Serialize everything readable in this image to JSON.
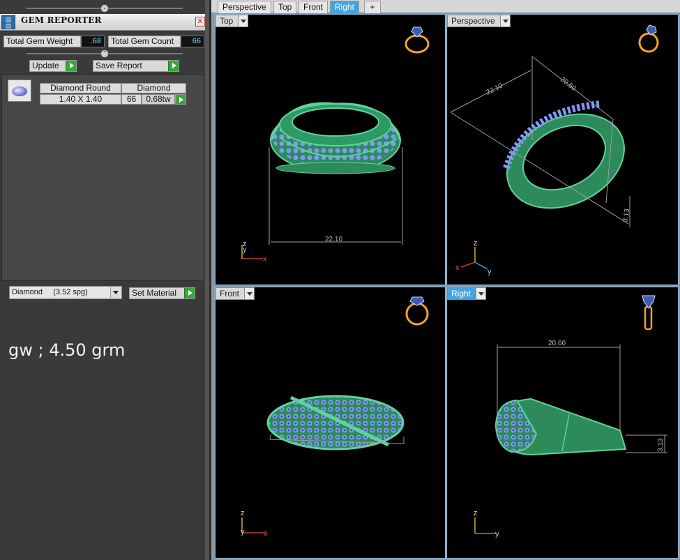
{
  "gem_reporter": {
    "title": "GEM REPORTER",
    "close_label": "✕",
    "total_gem_weight_label": "Total Gem Weight",
    "total_gem_weight_value": ".68",
    "total_gem_count_label": "Total Gem Count",
    "total_gem_count_value": "66",
    "update_label": "Update",
    "save_report_label": "Save Report",
    "gem_table": {
      "headers": [
        "Diamond Round",
        "Diamond"
      ],
      "rows": [
        {
          "size": "1.40 X 1.40",
          "count": "66",
          "weight": "0.68tw"
        }
      ]
    },
    "material": "Diamond     (3.52 spg)",
    "set_material_label": "Set Material"
  },
  "note": "gw ; 4.50 grm",
  "tabs": [
    "Perspective",
    "Top",
    "Front",
    "Right"
  ],
  "tab_add_label": "+",
  "active_tab": "Right",
  "viewports": {
    "top_left": {
      "label": "Top",
      "dimension": "22.10",
      "axes": [
        "z",
        "y",
        "x"
      ]
    },
    "top_right": {
      "label": "Perspective",
      "dimensions": [
        "22.10",
        "20.60",
        "3.13"
      ],
      "axes": [
        "z",
        "x",
        "y"
      ]
    },
    "bottom_left": {
      "label": "Front",
      "axes": [
        "z",
        "y",
        "x"
      ]
    },
    "bottom_right": {
      "label": "Right",
      "dimensions": [
        "20.60",
        "3.13"
      ],
      "axes": [
        "z",
        "y"
      ]
    }
  },
  "colors": {
    "ring_green": "#3fae75",
    "gem_blue": "#6f8df0",
    "gem_purple": "#4b3aa0",
    "icon_orange": "#f2a22e",
    "active_blue": "#47a3e0"
  }
}
